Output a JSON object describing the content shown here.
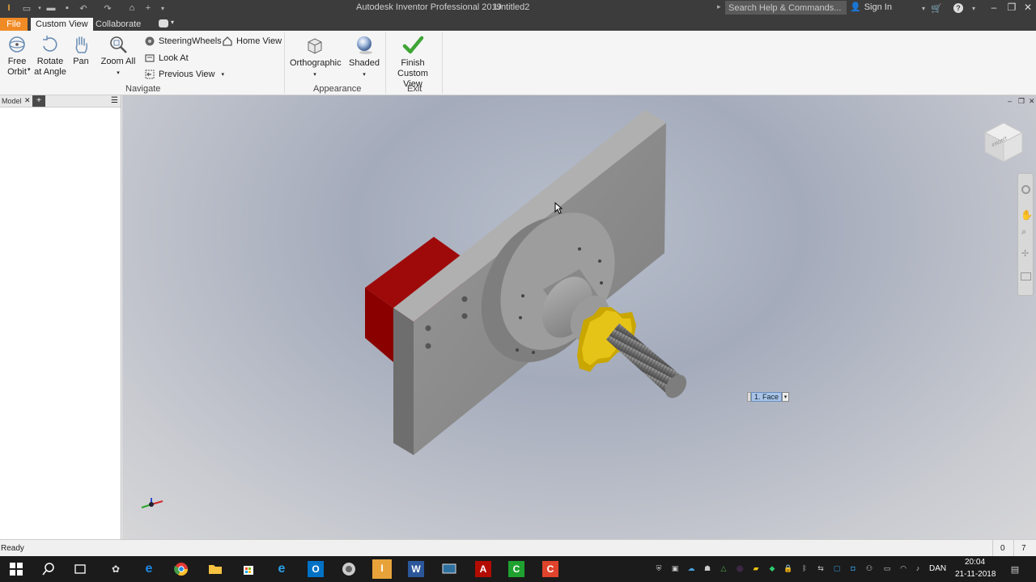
{
  "app": {
    "title": "Autodesk Inventor Professional 2019",
    "document": "Untitled2",
    "search_placeholder": "Search Help & Commands...",
    "sign_in": "Sign In"
  },
  "tabs": {
    "file": "File",
    "custom_view": "Custom View",
    "collaborate": "Collaborate"
  },
  "ribbon": {
    "navigate": {
      "free_orbit_line1": "Free",
      "free_orbit_line2": "Orbit",
      "rotate_line1": "Rotate",
      "rotate_line2": "at Angle",
      "pan": "Pan",
      "zoom_all": "Zoom All",
      "steering_wheels": "SteeringWheels",
      "home_view": "Home View",
      "look_at": "Look At",
      "previous_view": "Previous View",
      "label": "Navigate"
    },
    "appearance": {
      "orthographic": "Orthographic",
      "shaded": "Shaded",
      "label": "Appearance"
    },
    "exit": {
      "finish_line1": "Finish Custom",
      "finish_line2": "View",
      "label": "Exit"
    }
  },
  "browser": {
    "tab": "Model"
  },
  "viewport": {
    "selection_label": "1. Face",
    "viewcube_label": "FRONT"
  },
  "status": {
    "text": "Ready",
    "count_a": "0",
    "count_b": "7"
  },
  "taskbar": {
    "language": "DAN",
    "time": "20:04",
    "date": "21-11-2018",
    "apps": [
      {
        "name": "word",
        "label": "W",
        "color": "#2b579a"
      },
      {
        "name": "outlook",
        "label": "O",
        "color": "#0072c6"
      },
      {
        "name": "acrobat",
        "label": "A",
        "color": "#b30b00"
      },
      {
        "name": "camtasia",
        "label": "C",
        "color": "#1fa12f"
      }
    ]
  },
  "colors": {
    "file_tab": "#f08a24",
    "title_bg": "#3c3c3c",
    "plate": "#8c8c8c",
    "red_block": "#b30000",
    "yellow_knob": "#e3c414"
  }
}
